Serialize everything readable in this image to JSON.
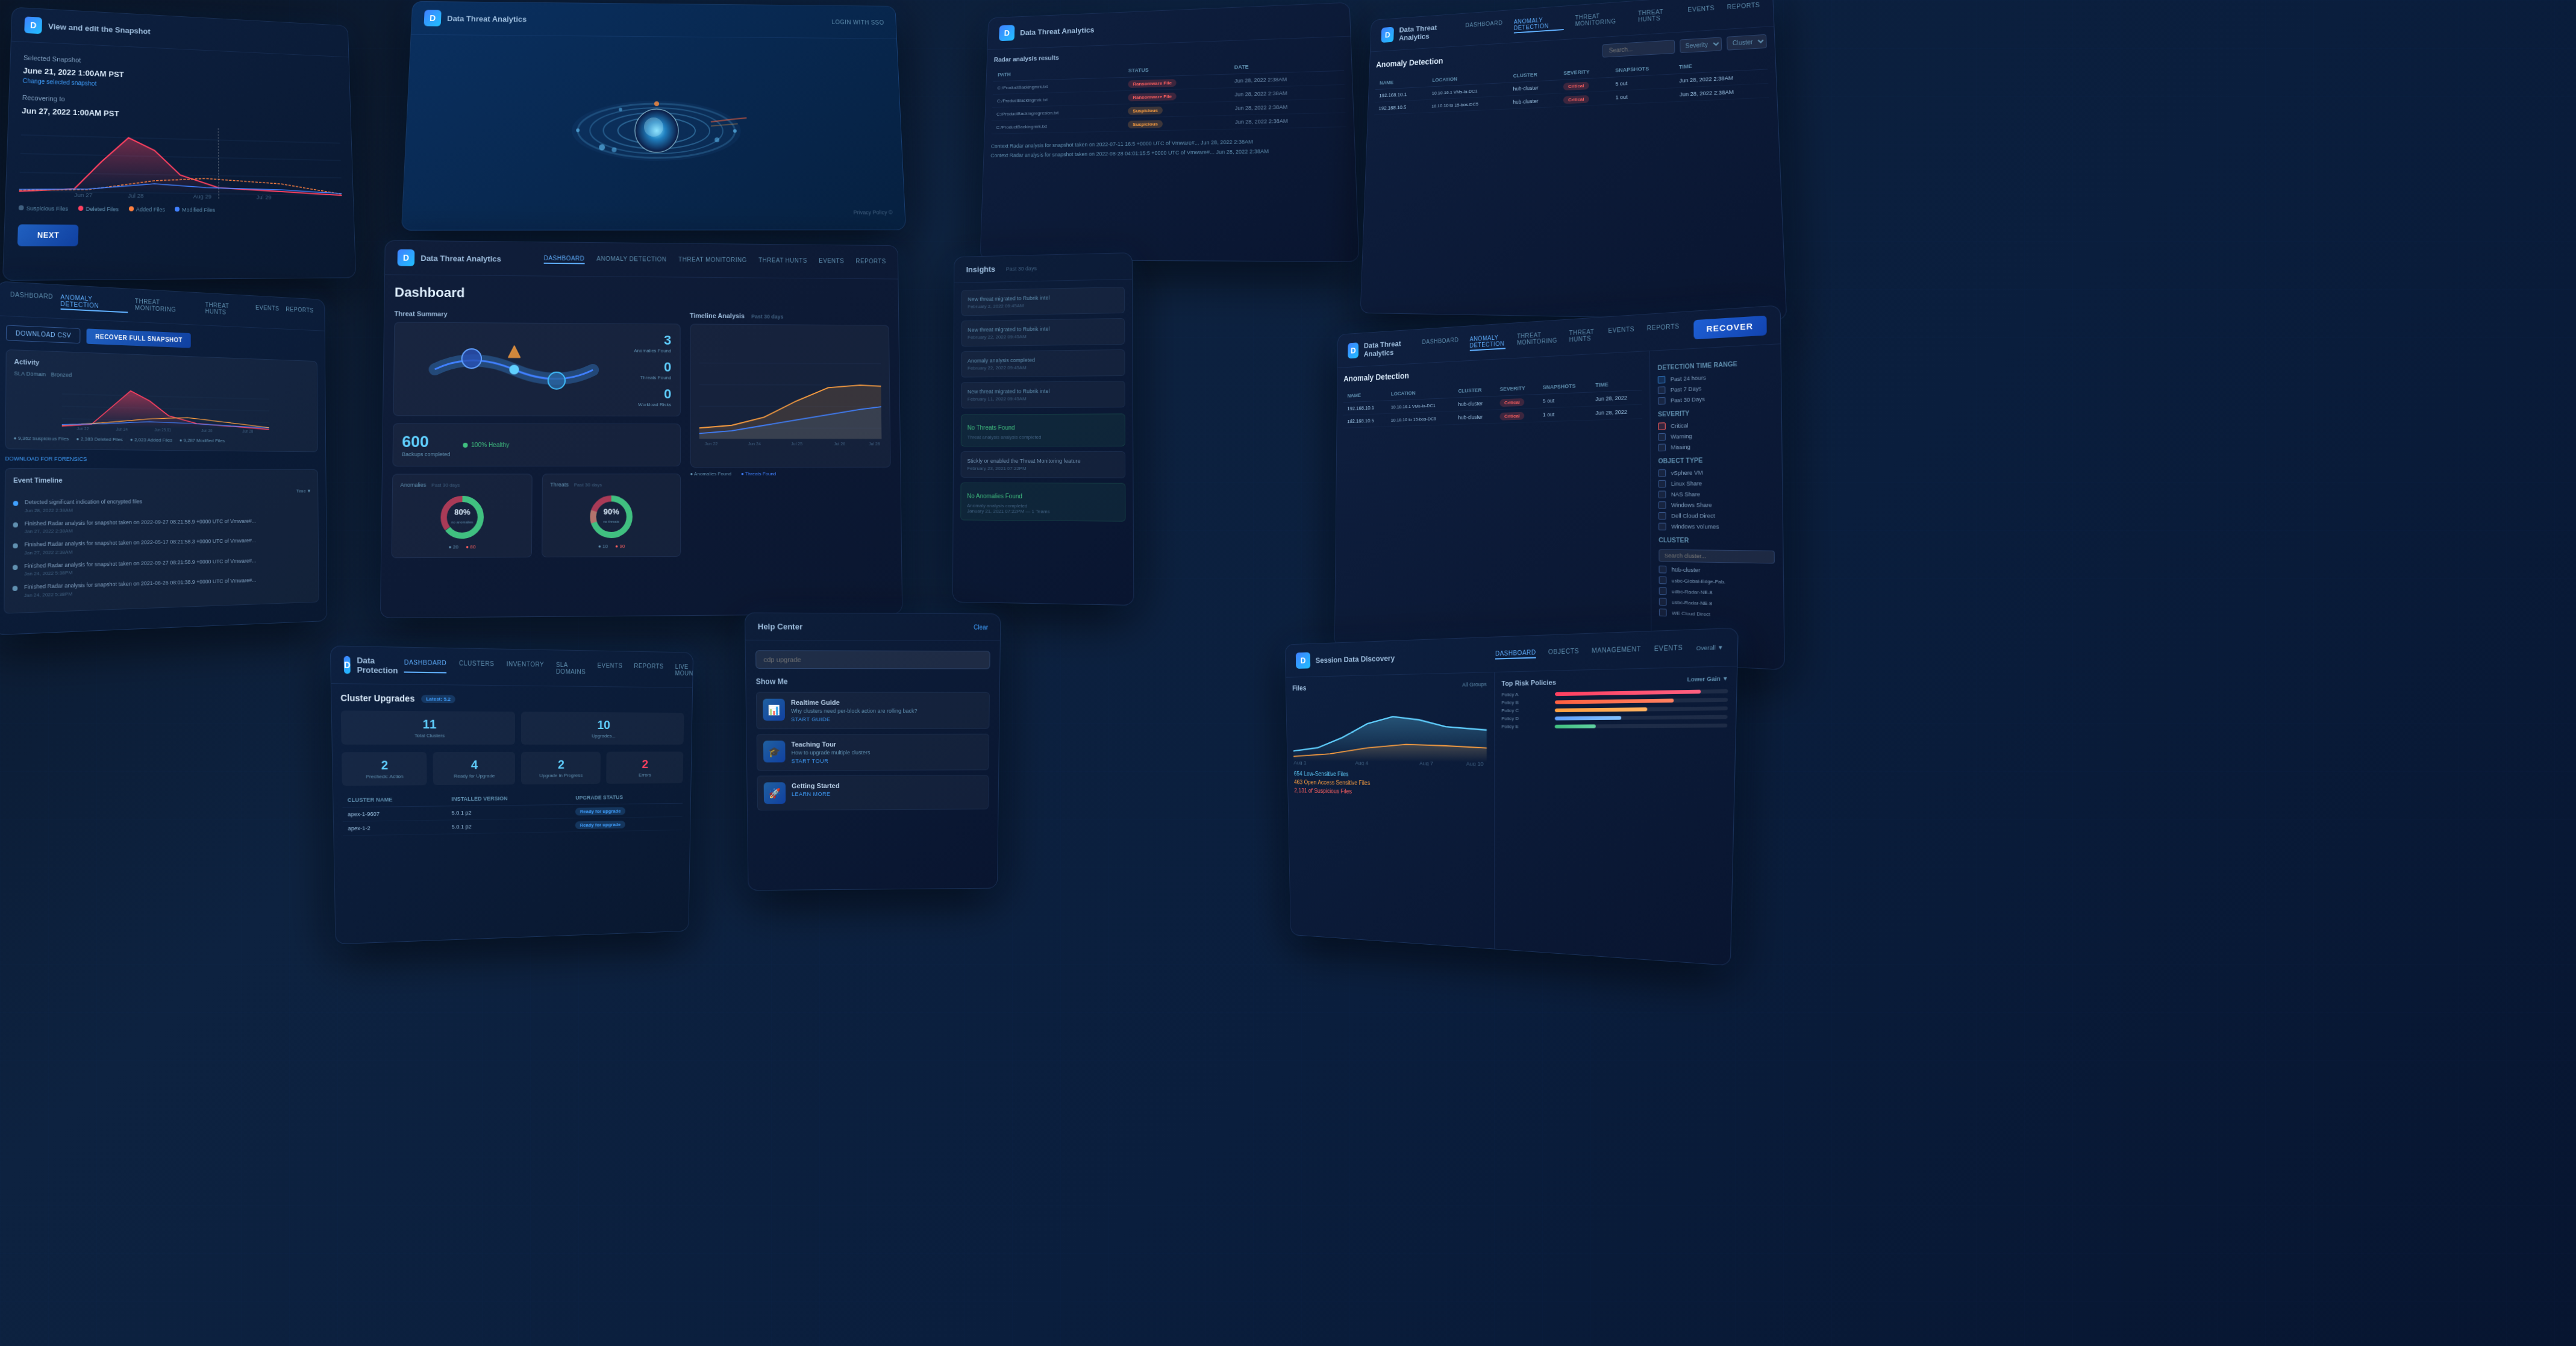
{
  "app": {
    "name": "Data Threat Analytics",
    "logo": "D"
  },
  "panels": {
    "recovery": {
      "title": "Selected Snapshot",
      "snapshot_date": "June 21, 2022 1:00AM PST",
      "change_link": "Change selected snapshot",
      "recovering_to_label": "Recovering to",
      "recovering_to_date": "Jun 27, 2022 1:00AM PST",
      "next_btn": "NEXT",
      "legend": {
        "suspicious": "Suspicious Files",
        "deleted": "Deleted Files",
        "added": "Added Files",
        "modified": "Modified Files"
      }
    },
    "viz3d": {
      "privacy_label": "Privacy Policy ©"
    },
    "file_analysis": {
      "title": "Radar analysis results",
      "columns": [
        "Path",
        "Status",
        "Date"
      ],
      "rows": [
        {
          "path": "C:/ProductBackingmrk.txt",
          "status": "Ransomware File",
          "date": "Jun 28, 2022 2:38AM",
          "status_type": "red"
        },
        {
          "path": "C:/ProductBackingmrk.txt",
          "status": "Ransomware File",
          "date": "Jun 28, 2022 2:38AM",
          "status_type": "red"
        },
        {
          "path": "C:/ProductBackingregresion.txt",
          "status": "Suspicious",
          "date": "Jun 28, 2022 2:38AM",
          "status_type": "orange"
        },
        {
          "path": "C:/ProductBackingmrk.txt",
          "status": "Suspicious",
          "date": "Jun 28, 2022 2:38AM",
          "status_type": "orange"
        }
      ]
    },
    "anomaly_left": {
      "nav": [
        "DASHBOARD",
        "ANOMALY DETECTION",
        "THREAT MONITORING",
        "THREAT HUNTS",
        "EVENTS",
        "REPORTS"
      ],
      "active_nav": "ANOMALY DETECTION",
      "buttons": [
        "DOWNLOAD CSV",
        "RECOVER FULL SNAPSHOT"
      ],
      "activity_title": "Activity",
      "sla_domain": "SLA Domain",
      "sla_value": "Bronzed",
      "stats": {
        "suspicious": "9,362 Suspicious Files",
        "deleted": "2,383 Deleted Files",
        "added": "2,023 Added Files",
        "modified": "9,287 Modified Files"
      },
      "download_label": "DOWNLOAD FOR FORENSICS",
      "timeline_title": "Event Timeline",
      "timeline_items": [
        {
          "text": "Detected significant indication of encrypted files",
          "time": "Jan 27, 2022 2:38AM"
        },
        {
          "text": "Finished Radar analysis for snapshot taken on 2022-09-27 08:21:58.9 +0000 UTC of Vmware#...",
          "time": "Jan 27, 2022 2:38AM"
        },
        {
          "text": "Finished Radar analysis for snapshot taken on 2022-05-17 08:21:58.3 +0000 UTC of Vmware#...",
          "time": "Jan 27, 2022 2:38AM"
        },
        {
          "text": "Finished Radar analysis for snapshot taken on 2022-09-27 08:21:58.9 +0000 UTC of Vmware#...",
          "time": "Jan 24, 2022 5:38PM"
        },
        {
          "text": "Finished Radar analysis for snapshot taken on 2021-06-26 08:01:38.9 +0000 UTC of Vmware#...",
          "time": "Jan 24, 2022 5:38PM"
        }
      ]
    },
    "dashboard": {
      "title": "Dashboard",
      "nav": [
        "DASHBOARD",
        "ANOMALY DETECTION",
        "THREAT MONITORING",
        "THREAT HUNTS",
        "EVENTS",
        "REPORTS"
      ],
      "active_nav": "DASHBOARD",
      "threat_summary_title": "Threat Summary",
      "stats": [
        {
          "number": "3",
          "label": "Anomalies Found"
        },
        {
          "number": "0",
          "label": "Threats Found"
        },
        {
          "number": "0",
          "label": "Workload Risks"
        }
      ],
      "total_vms": "600",
      "total_vms_label": "Backups completed",
      "health": "100% Healthy",
      "anomalies_title": "Anomalies",
      "anomalies_period": "Past 30 days",
      "anomalies_percent": "80%",
      "anomalies_sub": "Objects with no anomalies found",
      "anomalies_values": {
        "green": "20",
        "red": "80"
      },
      "threats_title": "Threats",
      "threats_period": "Past 30 days",
      "threats_percent": "90%",
      "threats_sub": "Objects with no threats Found",
      "threats_values": {
        "green": "10",
        "red": "90"
      },
      "timeline_title": "Timeline Analysis",
      "timeline_period": "Past 30 days"
    },
    "insights": {
      "title": "Insights",
      "period": "Past 30 days",
      "items": [
        {
          "label": "New threat migrated to Rubrik intel",
          "date": "February 2, 2022 09:45AM"
        },
        {
          "label": "New threat migrated to Rubrik intel",
          "date": "February 22, 2022 09:45AM"
        },
        {
          "label": "Anomaly analysis completed",
          "date": "February 22, 2022 09:45AM"
        },
        {
          "label": "New threat migrated to Rubrik intel",
          "date": "February 11, 2022 09:45AM"
        }
      ],
      "no_threats": "No Threats Found",
      "threat_analysis": "Threat analysis analysis completed",
      "threat_monitoring": "Stickly or enabled the Threat Monitoring feature",
      "no_anomalies": "No Anomalies Found",
      "anomaly_completed": "Anomaly analysis completed"
    },
    "anomaly_table": {
      "title": "Anomaly Detection",
      "nav": [
        "DASHBOARD",
        "ANOMALY DETECTION",
        "THREAT MONITORING",
        "THREAT HUNTS",
        "EVENTS",
        "REPORTS"
      ],
      "active_nav": "ANOMALY DETECTION",
      "columns": [
        "Name",
        "Location",
        "Cluster",
        "Severity",
        "Snapshots",
        "Time"
      ],
      "rows": [
        {
          "name": "192.168.10.1",
          "location": "10.10.16.1 VMs-la-DC1",
          "cluster": "hub-cluster",
          "severity": "Critical",
          "severity_type": "red",
          "snapshots": "5 out",
          "time": "Jun 28, 2022 2:38AM"
        },
        {
          "name": "192.168.10.5",
          "location": "10.10.10 to 15-bos-DC5",
          "cluster": "hub-cluster",
          "severity": "Critical",
          "severity_type": "red",
          "snapshots": "1 out",
          "time": "Jun 28, 2022 2:38AM"
        }
      ]
    },
    "anomaly_filter": {
      "title": "Anomaly Detection",
      "detection_time_label": "Detection Time Range",
      "time_options": [
        "Past 24 hours",
        "Past 7 days",
        "Past 30 days"
      ],
      "severity_label": "Severity",
      "severity_options": [
        "Critical",
        "Warning",
        "Missing"
      ],
      "object_type_label": "Object Type",
      "object_options": [
        "vSphere VM",
        "Linux Share",
        "NAS Share",
        "Windows Share",
        "Dell Cloud Direct",
        "Windows Volumes"
      ],
      "cluster_label": "Cluster",
      "cluster_options": [
        "hub-cluster",
        "usbc-Global Edge-Fab.",
        "udbc-Radar-NE-8",
        "usbc-Radar-NE-8",
        "WE Cloud Direct"
      ],
      "recover_button": "RECOVER"
    },
    "cluster_upgrades": {
      "title": "Cluster Upgrades",
      "latest_label": "Latest: 5.2",
      "stats": [
        {
          "number": "11",
          "label": "Total Clusters"
        },
        {
          "number": "10",
          "label": "Upgrades..."
        },
        {
          "number": "2",
          "label": "Precheck: Action"
        },
        {
          "number": "4",
          "label": "Ready for Upgrade"
        },
        {
          "number": "2",
          "label": "Upgrade in Progress"
        },
        {
          "number": "2",
          "label": "Errors"
        }
      ],
      "table_columns": [
        "Cluster name",
        "Installed Version",
        "Upgrade Status"
      ],
      "table_rows": [
        {
          "name": "apex-1-9607",
          "version": "5.0.1 p2",
          "status": "Ready for upgrade",
          "status_type": "blue"
        },
        {
          "name": "apex-1-2",
          "version": "5.0.1 p2",
          "status": "Ready for upgrade",
          "status_type": "blue"
        }
      ]
    },
    "help_center": {
      "title": "Help Center",
      "clear_label": "Clear",
      "search_placeholder": "cdp upgrade",
      "show_me_title": "Show Me",
      "guides": [
        {
          "title": "Realtime Guide",
          "subtitle": "Why clusters need per-block action are rolling back?",
          "link": "START GUIDE",
          "icon": "📊"
        },
        {
          "title": "Teaching Tour",
          "subtitle": "How to upgrade multiple clusters",
          "link": "START TOUR",
          "icon": "🎓"
        },
        {
          "title": "Getting Started",
          "link": "LEARN MORE",
          "icon": "🚀"
        }
      ]
    },
    "session_data": {
      "title": "Session Data Discovery",
      "nav": [
        "DASHBOARD",
        "OBJECTS",
        "MANAGEMENT",
        "EVENTS"
      ],
      "files_title": "Files",
      "all_groups": "All Groups",
      "stats": {
        "sensitive_files": "654 Low-Sensitive Files",
        "open_access": "463 Open Access Sensitive Files",
        "suspicious": "2,131 of Suspicious Files"
      },
      "top_risk_title": "Top Risk Policies",
      "policies": [
        {
          "name": "Policy A",
          "value": 85
        },
        {
          "name": "Policy B",
          "value": 70
        },
        {
          "name": "Policy C",
          "value": 55
        },
        {
          "name": "Policy D",
          "value": 40
        },
        {
          "name": "Policy E",
          "value": 25
        }
      ]
    }
  }
}
